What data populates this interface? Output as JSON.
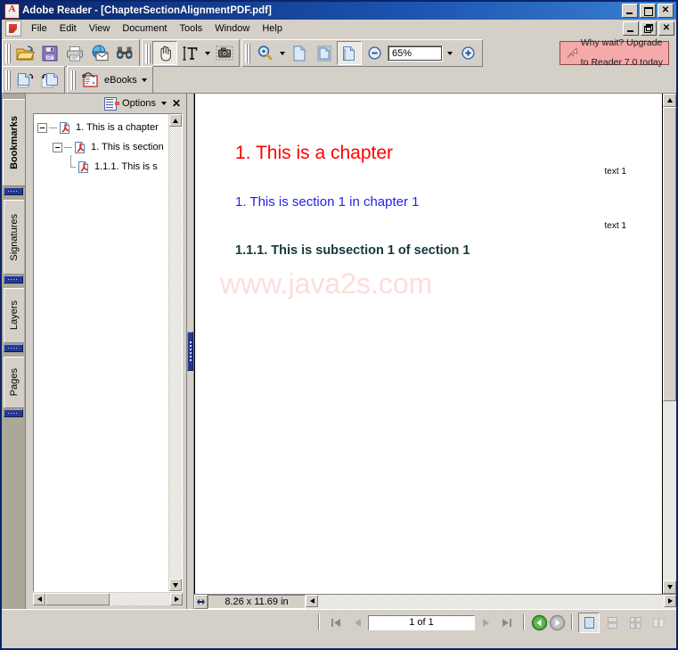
{
  "window": {
    "title": "Adobe Reader - [ChapterSectionAlignmentPDF.pdf]",
    "app_icon": "adobe-reader-icon",
    "controls": {
      "minimize": "_",
      "maximize": "□",
      "restore": "❐",
      "close": "✕"
    }
  },
  "menubar": {
    "items": [
      {
        "label": "File"
      },
      {
        "label": "Edit"
      },
      {
        "label": "View"
      },
      {
        "label": "Document"
      },
      {
        "label": "Tools"
      },
      {
        "label": "Window"
      },
      {
        "label": "Help"
      }
    ]
  },
  "toolbar": {
    "file_group": [
      {
        "name": "open-icon",
        "title": "Open"
      },
      {
        "name": "save-icon",
        "title": "Save a Copy"
      },
      {
        "name": "print-icon",
        "title": "Print"
      },
      {
        "name": "email-icon",
        "title": "Email"
      },
      {
        "name": "search-icon",
        "title": "Search"
      }
    ],
    "tools_group": [
      {
        "name": "hand-tool-icon",
        "title": "Hand Tool",
        "active": true
      },
      {
        "name": "select-text-icon",
        "title": "Select Text"
      },
      {
        "name": "snapshot-icon",
        "title": "Snapshot Tool"
      }
    ],
    "zoom_group": [
      {
        "name": "zoom-in-tool-icon",
        "title": "Zoom In Tool"
      }
    ],
    "page_display_group": [
      {
        "name": "actual-size-icon",
        "title": "Actual Size"
      },
      {
        "name": "fit-page-icon",
        "title": "Fit Page"
      },
      {
        "name": "fit-width-icon",
        "title": "Fit Width",
        "active": true
      }
    ],
    "zoom_out_icon": "zoom-out-icon",
    "zoom_in_icon": "zoom-in-icon",
    "zoom_value": "65%",
    "zoom_dropdown_icon": "chevron-down-icon",
    "promo": {
      "icon": "arrow-cursor-icon",
      "line1": "Why wait? Upgrade",
      "line2": "to Reader 7.0 today"
    },
    "row2": {
      "nav_icons": [
        {
          "name": "previous-view-icon",
          "title": "Previous View"
        },
        {
          "name": "next-view-icon",
          "title": "Next View"
        }
      ],
      "ebooks_icon": "ebooks-icon",
      "ebooks_label": "eBooks",
      "ebooks_dropdown_icon": "chevron-down-icon"
    }
  },
  "sidebar": {
    "tabs": [
      {
        "label": "Bookmarks",
        "active": true
      },
      {
        "label": "Signatures",
        "active": false
      },
      {
        "label": "Layers",
        "active": false
      },
      {
        "label": "Pages",
        "active": false
      }
    ],
    "panel": {
      "options_icon": "bookmark-options-icon",
      "options_label": "Options",
      "options_dropdown_icon": "chevron-down-icon",
      "close_icon": "close-icon",
      "bookmarks": [
        {
          "label": "1. This is a chapter",
          "level": 1,
          "expanded": true,
          "icon": "pdf-bookmark-icon"
        },
        {
          "label": "1. This is section",
          "level": 2,
          "expanded": true,
          "icon": "pdf-bookmark-icon"
        },
        {
          "label": "1.1.1. This is s",
          "level": 3,
          "expanded": false,
          "icon": "pdf-bookmark-icon"
        }
      ]
    }
  },
  "document": {
    "chapter_heading": "1. This is a chapter",
    "section_heading": "1. This is section 1 in chapter 1",
    "subsection_heading": "1.1.1. This is subsection 1 of section 1",
    "margin_note_1": "text 1",
    "margin_note_2": "text 1",
    "watermark": "www.java2s.com",
    "colors": {
      "chapter": "#ff0000",
      "section": "#2222ee",
      "subsection": "#16373a",
      "watermark": "#fbdedc"
    },
    "page_size": "8.26 x 11.69 in"
  },
  "statusbar": {
    "first_page_icon": "first-page-icon",
    "prev_page_icon": "previous-page-icon",
    "page_indicator": "1 of 1",
    "next_page_icon": "next-page-icon",
    "last_page_icon": "last-page-icon",
    "back_icon": "back-arrow-icon",
    "forward_icon": "forward-arrow-icon",
    "view_modes": [
      {
        "name": "single-page-view",
        "active": true
      },
      {
        "name": "continuous-view",
        "active": false
      },
      {
        "name": "continuous-facing-view",
        "active": false
      },
      {
        "name": "facing-view",
        "active": false
      }
    ]
  }
}
